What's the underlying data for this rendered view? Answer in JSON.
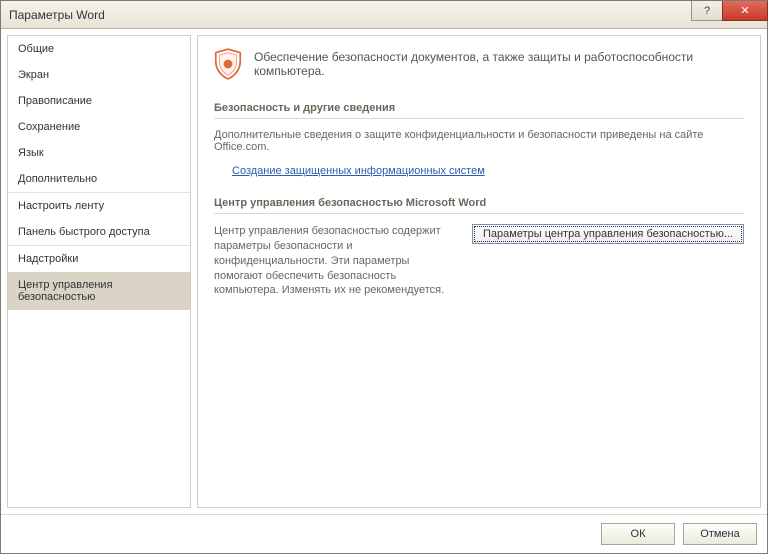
{
  "window": {
    "title": "Параметры Word"
  },
  "titlebar": {
    "help": "?",
    "close": "✕"
  },
  "sidebar": {
    "items": [
      {
        "label": "Общие"
      },
      {
        "label": "Экран"
      },
      {
        "label": "Правописание"
      },
      {
        "label": "Сохранение"
      },
      {
        "label": "Язык"
      },
      {
        "label": "Дополнительно"
      },
      {
        "label": "Настроить ленту"
      },
      {
        "label": "Панель быстрого доступа"
      },
      {
        "label": "Надстройки"
      },
      {
        "label": "Центр управления безопасностью"
      }
    ],
    "selectedIndex": 9
  },
  "main": {
    "hero": "Обеспечение безопасности документов, а также защиты и работоспособности компьютера.",
    "section1": {
      "title": "Безопасность и другие сведения",
      "text": "Дополнительные сведения о защите конфиденциальности и безопасности приведены на сайте Office.com.",
      "link": "Создание защищенных информационных систем"
    },
    "section2": {
      "title": "Центр управления безопасностью Microsoft Word",
      "text": "Центр управления безопасностью содержит параметры безопасности и конфиденциальности. Эти параметры помогают обеспечить безопасность компьютера. Изменять их не рекомендуется.",
      "button": "Параметры центра управления безопасностью..."
    }
  },
  "footer": {
    "ok": "ОК",
    "cancel": "Отмена"
  }
}
